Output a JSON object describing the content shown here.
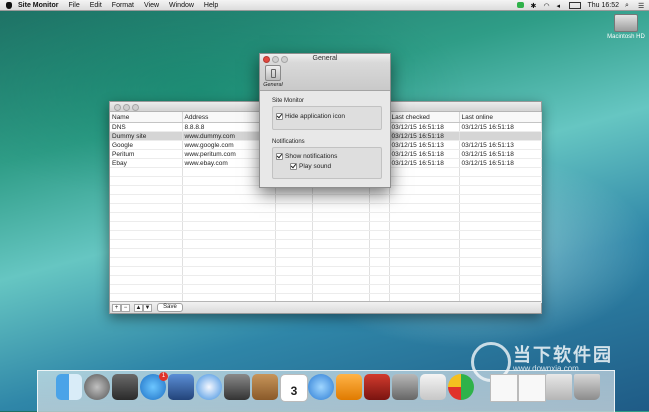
{
  "menubar": {
    "app_name": "Site Monitor",
    "menus": [
      "File",
      "Edit",
      "Format",
      "View",
      "Window",
      "Help"
    ],
    "clock": "Thu 16:52"
  },
  "desktop": {
    "disk_label": "Macintosh HD"
  },
  "main_window": {
    "columns": [
      "Name",
      "Address",
      "",
      "",
      "",
      "Last checked",
      "Last online"
    ],
    "rows": [
      {
        "name": "DNS",
        "address": "8.8.8.8",
        "last_checked": "03/12/15 16:51:18",
        "last_online": "03/12/15 16:51:18"
      },
      {
        "name": "Dummy site",
        "address": "www.dummy.com",
        "last_checked": "03/12/15 16:51:18",
        "last_online": ""
      },
      {
        "name": "Google",
        "address": "www.google.com",
        "last_checked": "03/12/15 16:51:13",
        "last_online": "03/12/15 16:51:13"
      },
      {
        "name": "Peritum",
        "address": "www.peritum.com",
        "last_checked": "03/12/15 16:51:18",
        "last_online": "03/12/15 16:51:18"
      },
      {
        "name": "Ebay",
        "address": "www.ebay.com",
        "last_checked": "03/12/15 16:51:18",
        "last_online": "03/12/15 16:51:18"
      }
    ],
    "selected_row": 1,
    "bottom": {
      "add": "+",
      "remove": "−",
      "up": "▲",
      "down": "▼",
      "save_label": "Save"
    }
  },
  "prefs_window": {
    "title": "General",
    "tab_label": "General",
    "section_site_monitor": "Site Monitor",
    "hide_icon": {
      "label": "Hide application icon",
      "checked": true
    },
    "section_notifications": "Notifications",
    "show_notifications": {
      "label": "Show notifications",
      "checked": true
    },
    "play_sound": {
      "label": "Play sound",
      "checked": true
    }
  },
  "dock": {
    "icons": [
      "finder-icon",
      "launchpad-icon",
      "photo-icon",
      "app-store-icon",
      "preview-icon",
      "safari-icon",
      "facetime-icon",
      "contacts-icon",
      "calendar-icon",
      "itunes-icon",
      "ibooks-icon",
      "photo-booth-icon",
      "system-preferences-icon",
      "textedit-icon",
      "site-monitor-icon",
      "document-icon",
      "document-icon",
      "folder-icon",
      "trash-icon"
    ],
    "calendar_day": "3",
    "badge": "1"
  },
  "watermark": {
    "main": "当下软件园",
    "url": "www.downxia.com"
  }
}
